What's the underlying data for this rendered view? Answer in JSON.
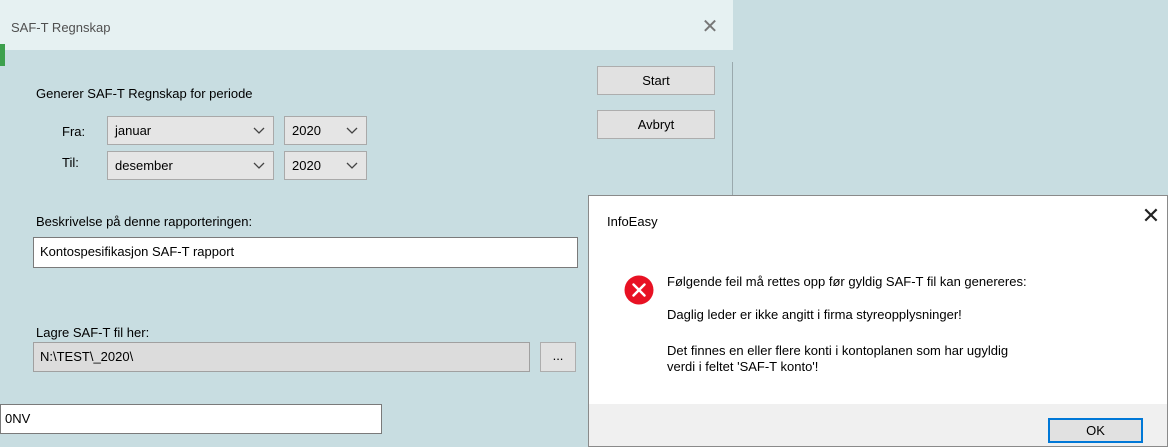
{
  "background_app": {
    "field_value": "0NV"
  },
  "main_dialog": {
    "title": "SAF-T Regnskap",
    "close_glyph": "✕",
    "period_heading": "Generer SAF-T Regnskap for periode",
    "from_label": "Fra:",
    "from_month": "januar",
    "from_year": "2020",
    "to_label": "Til:",
    "to_month": "desember",
    "to_year": "2020",
    "description_label": "Beskrivelse på denne rapporteringen:",
    "description_value": "Kontospesifikasjon SAF-T rapport",
    "save_label": "Lagre SAF-T fil her:",
    "save_path": "N:\\TEST\\_2020\\",
    "browse_label": "...",
    "start_label": "Start",
    "cancel_label": "Avbryt"
  },
  "message_box": {
    "title": "InfoEasy",
    "close_glyph": "✕",
    "icon": "error-icon",
    "line1": "Følgende feil må rettes opp før gyldig SAF-T fil kan genereres:",
    "line2": "Daglig leder er ikke angitt i firma styreopplysninger!",
    "line3a": "Det finnes en eller flere konti i kontoplanen som har ugyldig",
    "line3b": "verdi i feltet 'SAF-T konto'!",
    "ok_label": "OK"
  },
  "colors": {
    "dialog_bg": "#c8dde1",
    "error_red": "#e81123",
    "focus_blue": "#0078d7"
  }
}
